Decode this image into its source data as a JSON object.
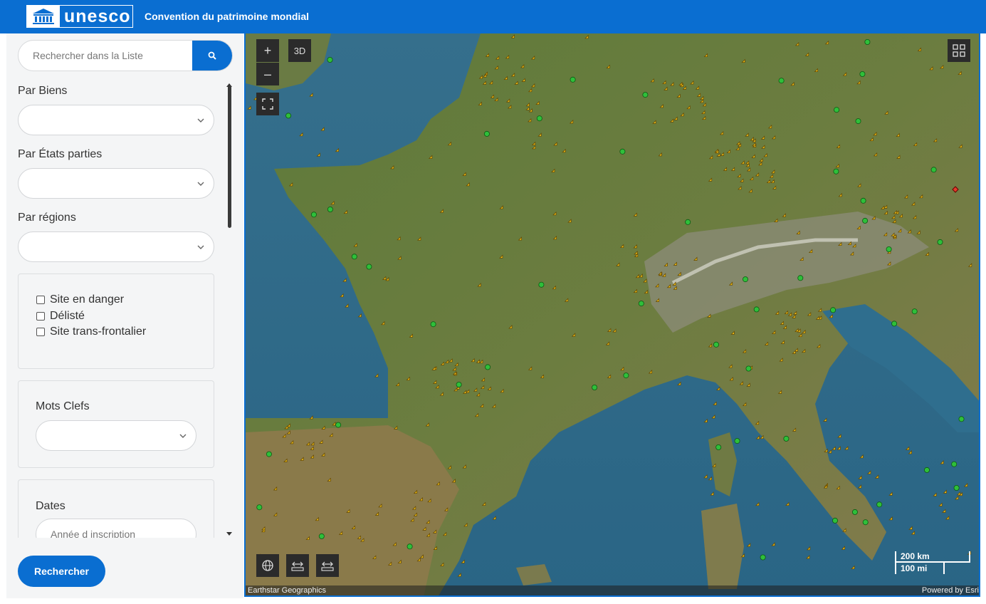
{
  "header": {
    "logo_text": "unesco",
    "title": "Convention du patrimoine mondial",
    "accent": "#0a6ed1"
  },
  "sidebar": {
    "search": {
      "placeholder": "Rechercher dans la Liste",
      "icon": "search-icon"
    },
    "filters": {
      "biens_label": "Par Biens",
      "etats_label": "Par États parties",
      "regions_label": "Par régions"
    },
    "checkboxes": [
      {
        "label": "Site en danger",
        "checked": false
      },
      {
        "label": "Délisté",
        "checked": false
      },
      {
        "label": "Site trans-frontalier",
        "checked": false
      }
    ],
    "keywords_label": "Mots Clefs",
    "dates_label": "Dates",
    "year_placeholder": "Année d inscription",
    "submit_label": "Rechercher"
  },
  "map": {
    "zoom_in": "+",
    "zoom_out": "–",
    "view_3d": "3D",
    "scale_km": "200 km",
    "scale_mi": "100 mi",
    "attribution_left": "Earthstar Geographics",
    "attribution_right": "Powered by Esri",
    "marker_colors": {
      "cultural": "#f2c21b",
      "natural": "#2fbf3a",
      "danger": "#e53b2b",
      "outline": "#6b4d00"
    }
  }
}
